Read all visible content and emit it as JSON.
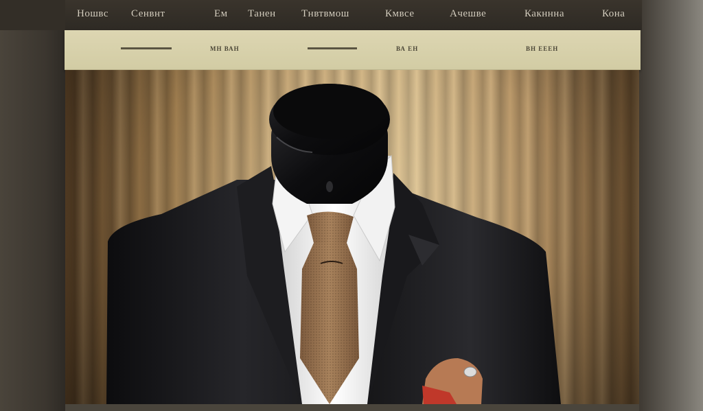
{
  "top_nav": {
    "items": [
      "Ношвс",
      "Сенвнт",
      "Ем",
      "Танен",
      "Тнвтвмош",
      "Кмвсе",
      "Ачешве",
      "Какннна",
      "Кона"
    ]
  },
  "sub_nav": {
    "items": [
      "——",
      "МН ВАН",
      "——",
      "ВА ЕН",
      "ВН ЕЕЕН"
    ]
  },
  "hero": {
    "image_subject": "mannequin-in-suit"
  },
  "colors": {
    "top_bar": "#2e2a24",
    "sub_bar": "#d8d2ac",
    "suit": "#1a1a1c",
    "tie": "#9a7452",
    "curtain": "#c7a878"
  }
}
